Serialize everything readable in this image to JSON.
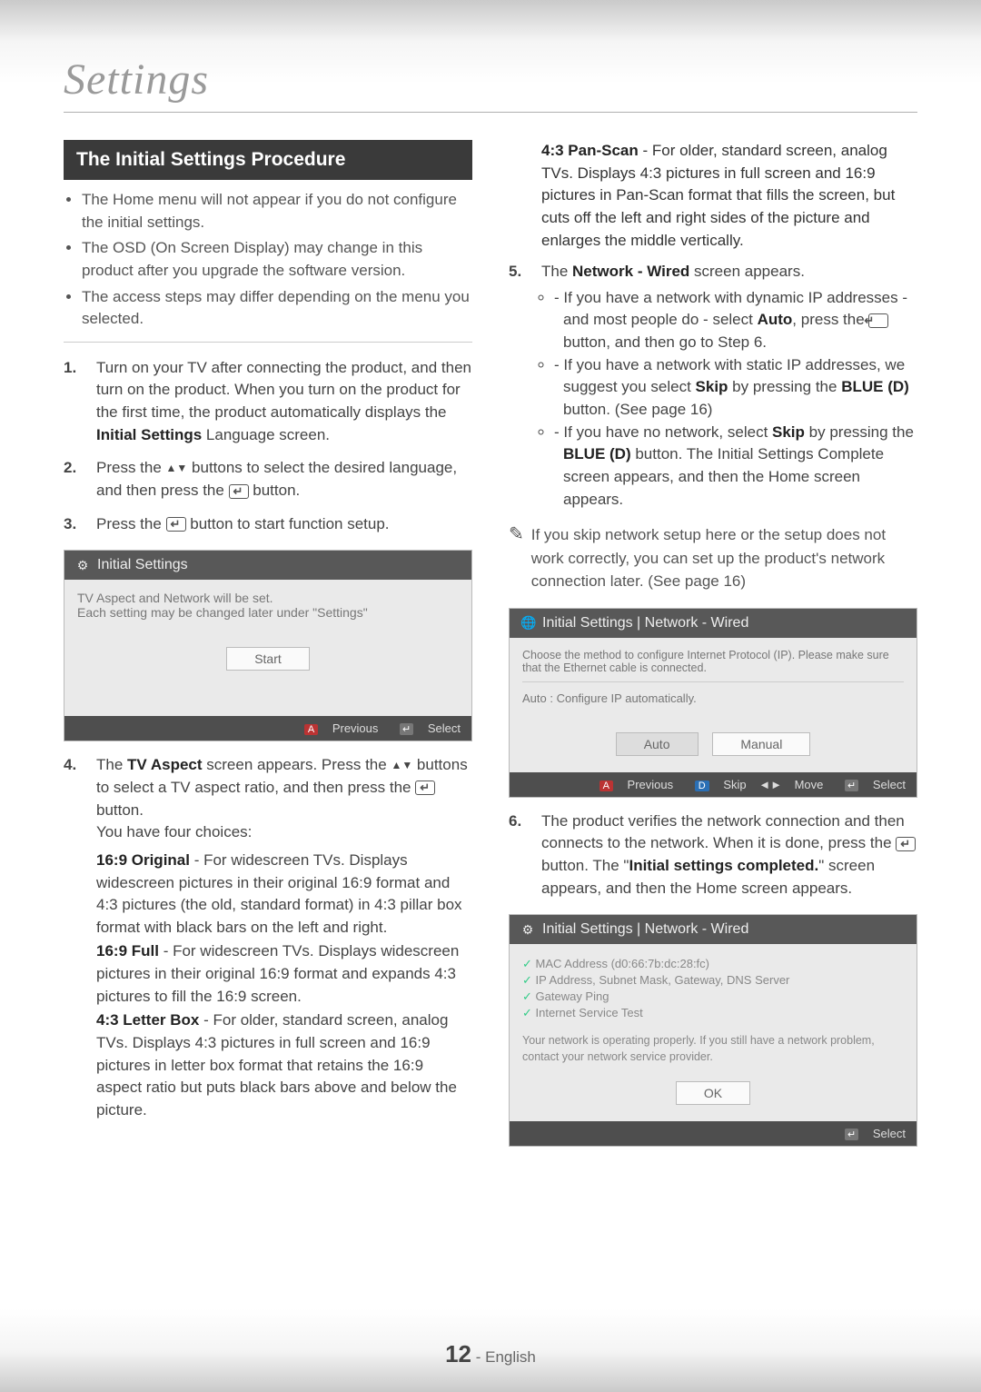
{
  "section_title": "Settings",
  "bar_title": "The Initial Settings Procedure",
  "lead_bullets": [
    "The Home menu will not appear if you do not configure the initial settings.",
    "The OSD (On Screen Display) may change in this product after you upgrade the software version.",
    "The access steps may differ depending on the menu you selected."
  ],
  "steps": {
    "s1": {
      "num": "1.",
      "text_before": "Turn on your TV after connecting the product, and then turn on the product. When you turn on the product for the first time, the product automatically displays the ",
      "bold": "Initial Settings",
      "text_after": " Language screen."
    },
    "s2": {
      "num": "2.",
      "text_before": "Press the ",
      "tri": "▲▼",
      "text_mid": " buttons to select the desired language, and then press the ",
      "text_after": " button."
    },
    "s3": {
      "num": "3.",
      "text_before": "Press the ",
      "text_after": " button to start function setup."
    },
    "s4": {
      "num": "4.",
      "lead_before": "The ",
      "lead_bold": "TV Aspect",
      "lead_mid": " screen appears. Press the ",
      "tri": "▲▼",
      "lead_mid2": " buttons to select a TV aspect ratio, and then press the ",
      "lead_after": " button.",
      "sub_lead": "You have four choices:",
      "c1_b": "16:9 Original",
      "c1": " - For widescreen TVs. Displays widescreen pictures in their original 16:9 format and 4:3 pictures (the old, standard format) in 4:3 pillar box format with black bars on the left and right.",
      "c2_b": "16:9 Full",
      "c2": " - For widescreen TVs. Displays widescreen pictures in their original 16:9 format and expands 4:3 pictures to fill the 16:9 screen.",
      "c3_b": "4:3 Letter Box",
      "c3": " - For older, standard screen, analog TVs. Displays 4:3 pictures in full screen and 16:9 pictures in letter box format that retains the 16:9 aspect ratio but puts black bars above and below the picture.",
      "c4_b": "4:3 Pan-Scan",
      "c4": " - For older, standard screen, analog TVs. Displays 4:3 pictures in full screen and 16:9 pictures in Pan-Scan format that fills the screen, but cuts off the left and right sides of the picture and enlarges the middle vertically."
    },
    "s5": {
      "num": "5.",
      "lead_before": "The ",
      "lead_bold": "Network - Wired",
      "lead_after": " screen appears.",
      "b1_a": "If you have a network with dynamic IP addresses - and most people do - select ",
      "b1_bold": "Auto",
      "b1_b": ", press the ",
      "b1_c": " button, and then go to Step 6.",
      "b2_a": "If you have a network with static IP addresses, we suggest you select ",
      "b2_bold": "Skip",
      "b2_b": " by pressing the ",
      "b2_bold2": "BLUE (D)",
      "b2_c": " button. (See page 16)",
      "b3_a": "If you have no network, select ",
      "b3_bold": "Skip",
      "b3_b": " by pressing the ",
      "b3_bold2": "BLUE (D)",
      "b3_c": " button. The Initial Settings Complete screen appears, and then the Home screen appears."
    },
    "s6": {
      "num": "6.",
      "text_a": "The product verifies the network connection and then connects to the network. When it is done, press the ",
      "text_b": " button. The \"",
      "bold": "Initial settings completed.",
      "text_c": "\" screen appears, and then the Home screen appears."
    }
  },
  "note_text": "If you skip network setup here or the setup does not work correctly, you can set up the product's network connection later. (See page 16)",
  "panel1": {
    "title": "Initial Settings",
    "line1": "TV Aspect and Network will be set.",
    "line2": "Each setting may be changed later under \"Settings\"",
    "start_btn": "Start",
    "foot_prev": "Previous",
    "foot_sel": "Select"
  },
  "panel2": {
    "title": "Initial Settings | Network - Wired",
    "desc": "Choose the method to configure Internet Protocol (IP). Please make sure that the Ethernet cable is connected.",
    "auto_desc": "Auto : Configure IP automatically.",
    "btn_auto": "Auto",
    "btn_manual": "Manual",
    "foot_prev": "Previous",
    "foot_skip": "Skip",
    "foot_move": "Move",
    "foot_sel": "Select"
  },
  "panel3": {
    "title": "Initial Settings | Network - Wired",
    "check1": "MAC Address (d0:66:7b:dc:28:fc)",
    "check2": "IP Address, Subnet Mask, Gateway, DNS Server",
    "check3": "Gateway Ping",
    "check4": "Internet Service Test",
    "msg": "Your network is operating properly. If you still have a network problem, contact your network service provider.",
    "ok_btn": "OK",
    "foot_sel": "Select"
  },
  "footer": {
    "page_num": "12",
    "sep": " - ",
    "lang": "English"
  }
}
